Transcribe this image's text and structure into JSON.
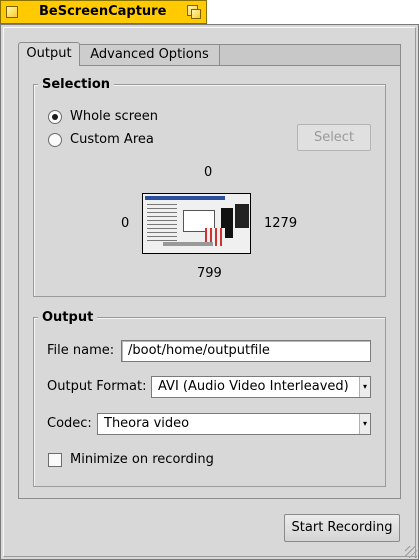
{
  "window": {
    "title": "BeScreenCapture"
  },
  "tabs": [
    {
      "label": "Output",
      "selected": true
    },
    {
      "label": "Advanced Options",
      "selected": false
    }
  ],
  "selection": {
    "group_label": "Selection",
    "options": [
      {
        "label": "Whole screen",
        "selected": true
      },
      {
        "label": "Custom Area",
        "selected": false
      }
    ],
    "select_button": "Select",
    "coords": {
      "top": "0",
      "left": "0",
      "right": "1279",
      "bottom": "799"
    }
  },
  "output": {
    "group_label": "Output",
    "file_name_label": "File name:",
    "file_name_value": "/boot/home/outputfile",
    "format_label": "Output Format:",
    "format_value": "AVI (Audio Video Interleaved)",
    "codec_label": "Codec:",
    "codec_value": "Theora video",
    "minimize_label": "Minimize on recording",
    "minimize_checked": false
  },
  "start_button": "Start Recording",
  "icons": {
    "close": "close-box-icon",
    "zoom": "zoom-box-icon",
    "dropdown": "chevron-down-icon",
    "resize": "resize-grip-icon"
  },
  "colors": {
    "title_tab": "#ffcb00",
    "window_bg": "#d8d8d8"
  }
}
